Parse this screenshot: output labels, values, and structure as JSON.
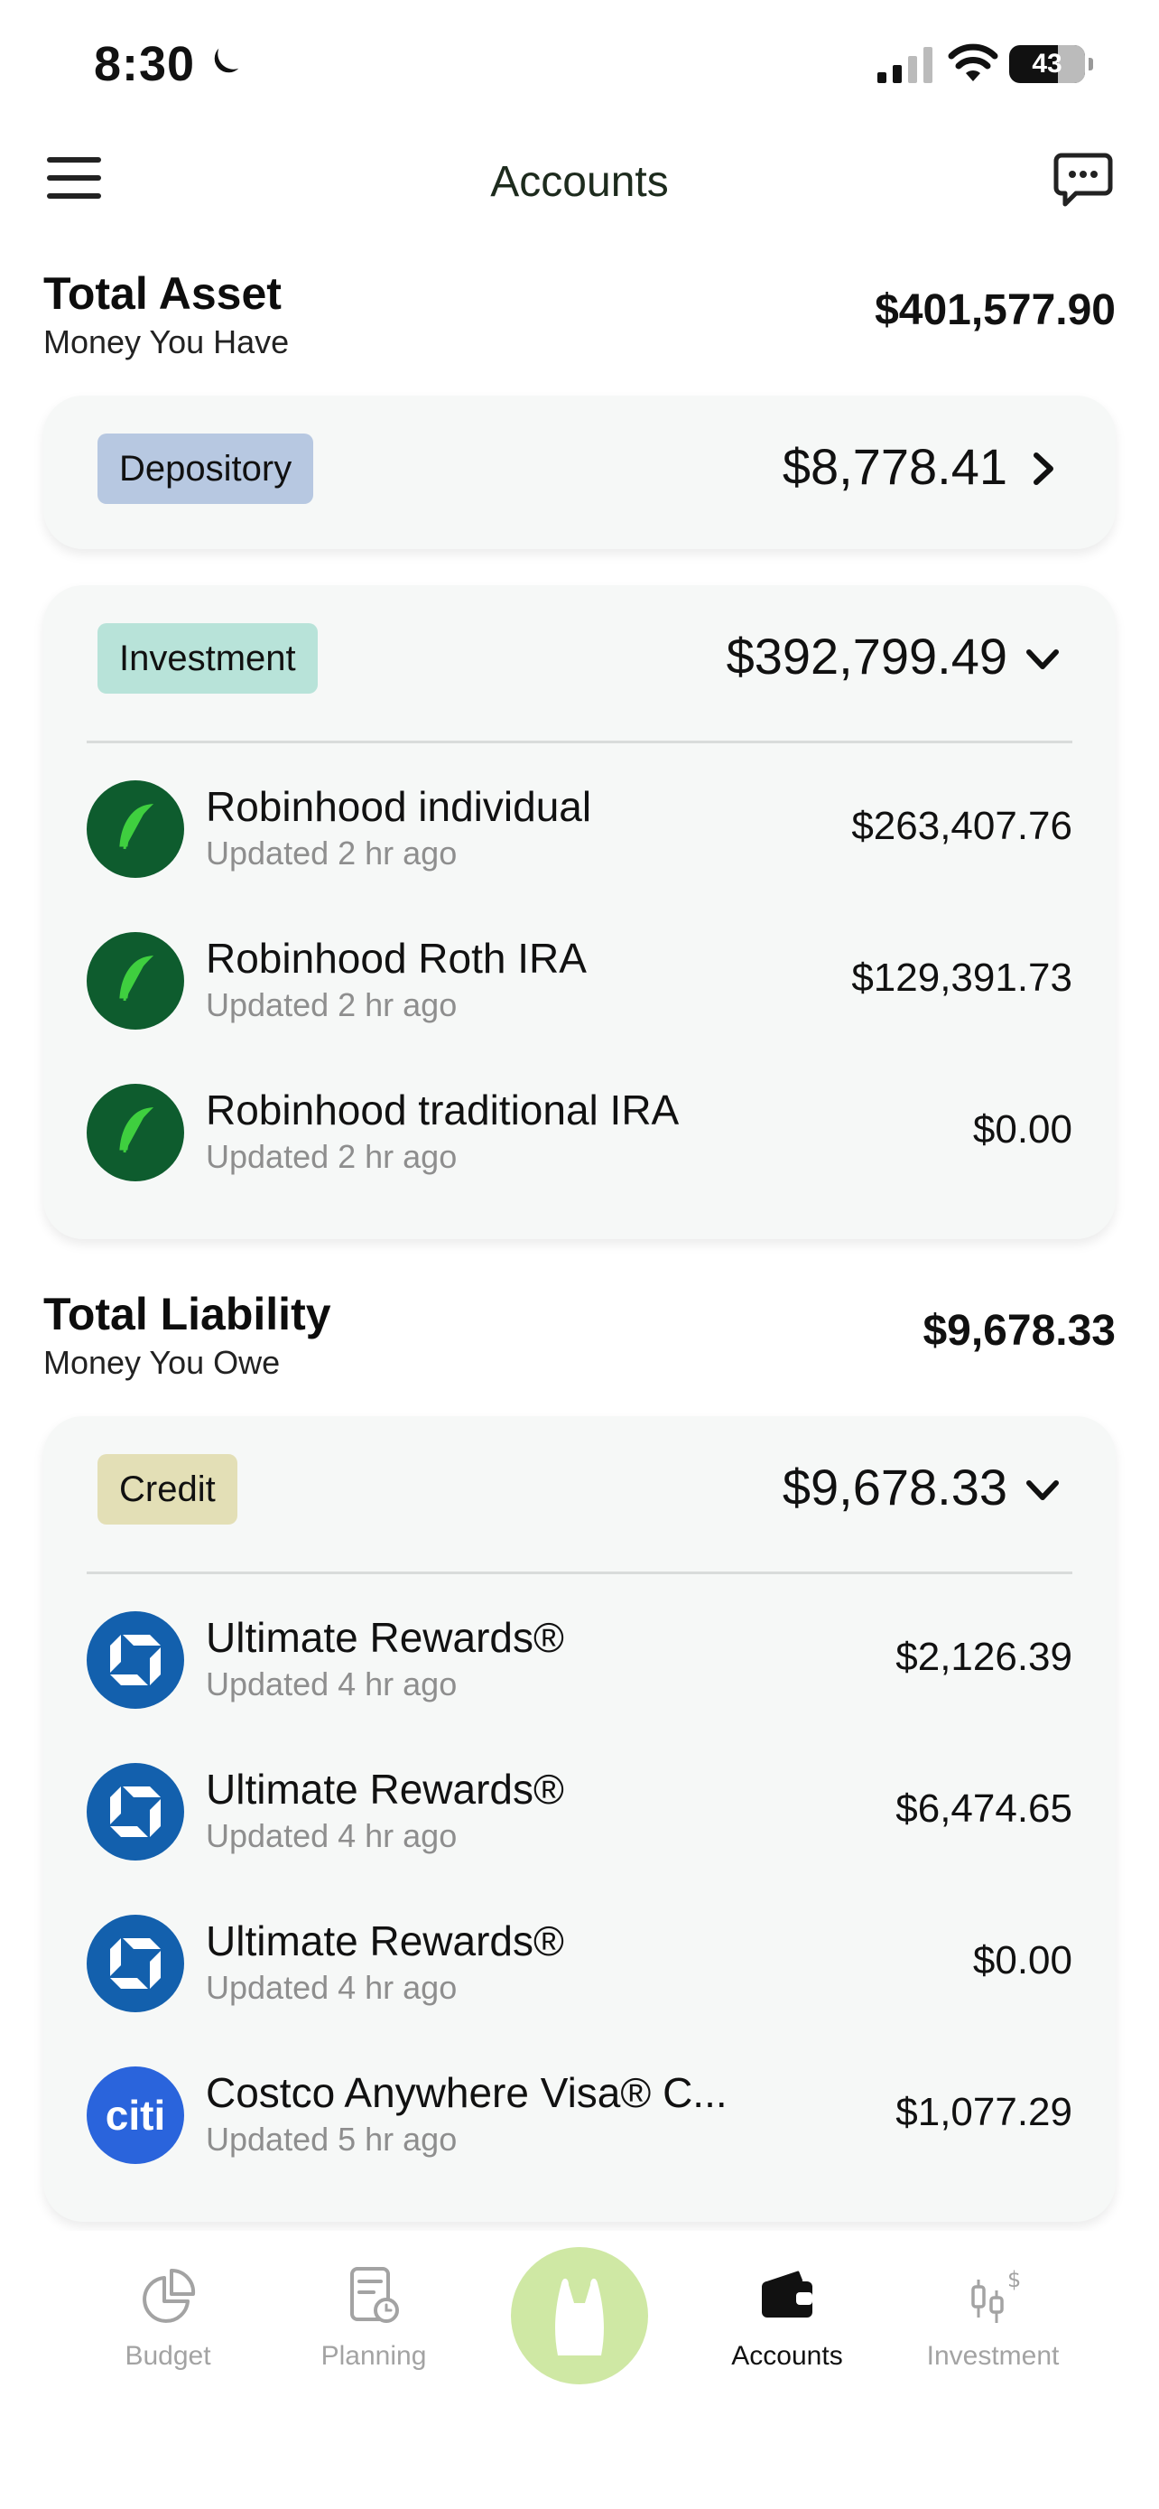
{
  "status_bar": {
    "time": "8:30",
    "battery": "43"
  },
  "header": {
    "title": "Accounts"
  },
  "total_asset": {
    "title": "Total Asset",
    "subtitle": "Money You Have",
    "amount": "$401,577.90"
  },
  "depository": {
    "label": "Depository",
    "amount": "$8,778.41"
  },
  "investment": {
    "label": "Investment",
    "amount": "$392,799.49",
    "accounts": [
      {
        "name": "Robinhood individual",
        "updated": "Updated 2 hr ago",
        "amount": "$263,407.76"
      },
      {
        "name": "Robinhood Roth IRA",
        "updated": "Updated 2 hr ago",
        "amount": "$129,391.73"
      },
      {
        "name": "Robinhood traditional IRA",
        "updated": "Updated 2 hr ago",
        "amount": "$0.00"
      }
    ]
  },
  "total_liability": {
    "title": "Total Liability",
    "subtitle": "Money You Owe",
    "amount": "$9,678.33"
  },
  "credit": {
    "label": "Credit",
    "amount": "$9,678.33",
    "accounts": [
      {
        "name": "Ultimate Rewards®",
        "updated": "Updated 4 hr ago",
        "amount": "$2,126.39"
      },
      {
        "name": "Ultimate Rewards®",
        "updated": "Updated 4 hr ago",
        "amount": "$6,474.65"
      },
      {
        "name": "Ultimate Rewards®",
        "updated": "Updated 4 hr ago",
        "amount": "$0.00"
      },
      {
        "name": "Costco Anywhere Visa® C...",
        "updated": "Updated 5 hr ago",
        "amount": "$1,077.29",
        "logo_text": "citi"
      }
    ]
  },
  "tabs": [
    {
      "label": "Budget",
      "icon": "pie-chart-icon"
    },
    {
      "label": "Planning",
      "icon": "document-clock-icon"
    },
    {
      "label": "",
      "icon": "bunny-icon"
    },
    {
      "label": "Accounts",
      "icon": "wallet-icon",
      "active": true
    },
    {
      "label": "Investment",
      "icon": "candlestick-dollar-icon"
    }
  ],
  "colors": {
    "card_bg": "#f6f8f7",
    "pill_depository": "#b7c8e1",
    "pill_investment": "#b8e3d9",
    "pill_credit": "#e3dfb6",
    "robinhood_green": "#0e5c2e",
    "chase_blue": "#1360ad",
    "citi_blue": "#2a64dc",
    "center_tab": "#cfe8a4"
  }
}
